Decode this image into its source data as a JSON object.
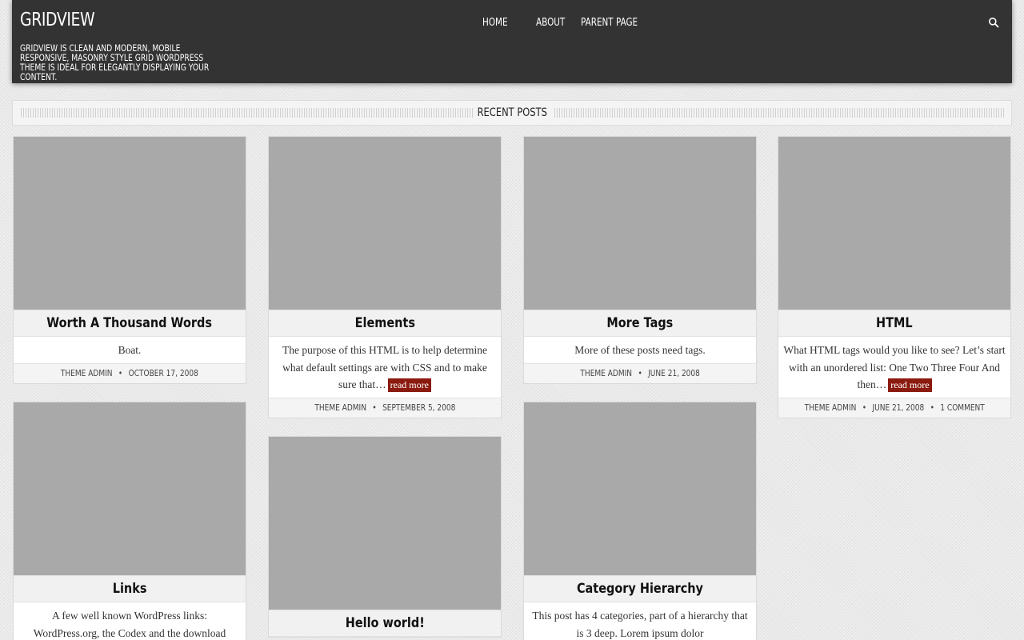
{
  "site": {
    "title": "GRIDVIEW",
    "description": "GRIDVIEW IS CLEAN AND MODERN, MOBILE RESPONSIVE, MASONRY STYLE GRID WORDPRESS THEME IS IDEAL FOR ELEGANTLY DISPLAYING YOUR CONTENT."
  },
  "nav": {
    "items": [
      {
        "label": "HOME"
      },
      {
        "label": "ABOUT"
      },
      {
        "label": "PARENT PAGE"
      }
    ],
    "search_icon": "search-icon"
  },
  "section": {
    "title": "RECENT POSTS"
  },
  "colors": {
    "header_bg": "#333333",
    "read_more_bg": "#8b1a0f",
    "thumb": "#a9a9a9"
  },
  "posts": [
    {
      "title": "Worth A Thousand Words",
      "excerpt": "Boat.",
      "read_more": "",
      "author": "THEME ADMIN",
      "date": "OCTOBER 17, 2008",
      "comments": ""
    },
    {
      "title": "Elements",
      "excerpt": "The purpose of this HTML is to help determine what default settings are with CSS and to make sure that…",
      "read_more": "read more",
      "author": "THEME ADMIN",
      "date": "SEPTEMBER 5, 2008",
      "comments": ""
    },
    {
      "title": "More Tags",
      "excerpt": "More of these posts need tags.",
      "read_more": "",
      "author": "THEME ADMIN",
      "date": "JUNE 21, 2008",
      "comments": ""
    },
    {
      "title": "HTML",
      "excerpt": "What HTML tags would you like to see? Let’s start with an unordered list: One Two Three Four And then…",
      "read_more": "read more",
      "author": "THEME ADMIN",
      "date": "JUNE 21, 2008",
      "comments": "1 COMMENT"
    },
    {
      "title": "Links",
      "excerpt": "A few well known WordPress links: WordPress.org, the Codex and the download",
      "read_more": "",
      "author": "",
      "date": "",
      "comments": ""
    },
    {
      "title": "Hello world!",
      "excerpt": "",
      "read_more": "",
      "author": "",
      "date": "",
      "comments": ""
    },
    {
      "title": "Category Hierarchy",
      "excerpt": "This post has 4 categories, part of a hierarchy that is 3 deep. Lorem ipsum dolor",
      "read_more": "",
      "author": "",
      "date": "",
      "comments": ""
    }
  ]
}
